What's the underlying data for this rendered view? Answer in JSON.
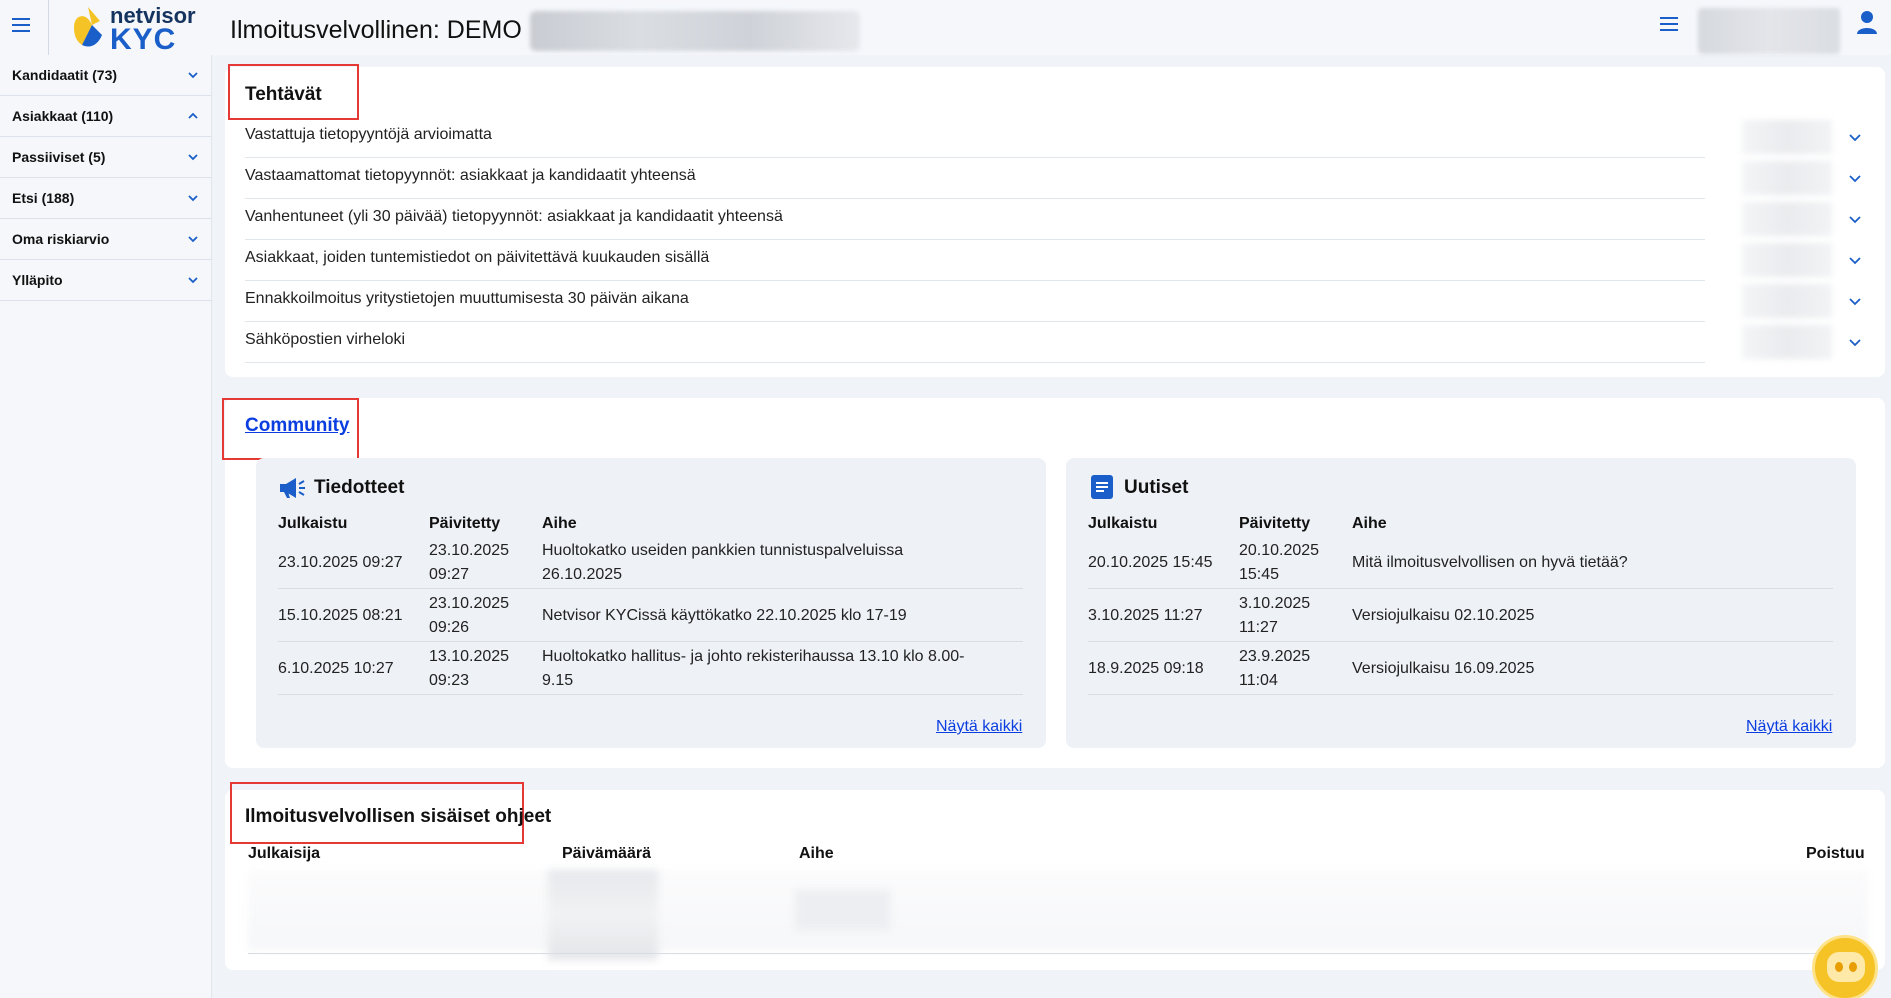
{
  "header": {
    "logo_line1": "netvisor",
    "logo_line2": "KYC",
    "title": "Ilmoitusvelvollinen: DEMO"
  },
  "sidebar": {
    "items": [
      {
        "label": "Kandidaatit (73)",
        "expanded": false
      },
      {
        "label": "Asiakkaat (110)",
        "expanded": true
      },
      {
        "label": "Passiiviset (5)",
        "expanded": false
      },
      {
        "label": "Etsi (188)",
        "expanded": false
      },
      {
        "label": "Oma riskiarvio",
        "expanded": false
      },
      {
        "label": "Ylläpito",
        "expanded": false
      }
    ]
  },
  "tasks": {
    "title": "Tehtävät",
    "rows": [
      "Vastattuja tietopyyntöjä arvioimatta",
      "Vastaamattomat tietopyynnöt: asiakkaat ja kandidaatit yhteensä",
      "Vanhentuneet (yli 30 päivää) tietopyynnöt: asiakkaat ja kandidaatit yhteensä",
      "Asiakkaat, joiden tuntemistiedot on päivitettävä kuukauden sisällä",
      "Ennakkoilmoitus yritystietojen muuttumisesta 30 päivän aikana",
      "Sähköpostien virheloki"
    ]
  },
  "community": {
    "title": "Community",
    "tiedotteet": {
      "title": "Tiedotteet",
      "columns": [
        "Julkaistu",
        "Päivitetty",
        "Aihe"
      ],
      "rows": [
        {
          "published": "23.10.2025 09:27",
          "updated_date": "23.10.2025",
          "updated_time": "09:27",
          "subject_line1": "Huoltokatko useiden pankkien tunnistuspalveluissa",
          "subject_line2": "26.10.2025"
        },
        {
          "published": "15.10.2025 08:21",
          "updated_date": "23.10.2025",
          "updated_time": "09:26",
          "subject_line1": "Netvisor KYCissä käyttökatko 22.10.2025 klo 17-19",
          "subject_line2": ""
        },
        {
          "published": "6.10.2025 10:27",
          "updated_date": "13.10.2025",
          "updated_time": "09:23",
          "subject_line1": "Huoltokatko hallitus- ja johto rekisterihaussa 13.10 klo 8.00-",
          "subject_line2": "9.15"
        }
      ],
      "show_all": "Näytä kaikki"
    },
    "uutiset": {
      "title": "Uutiset",
      "columns": [
        "Julkaistu",
        "Päivitetty",
        "Aihe"
      ],
      "rows": [
        {
          "published": "20.10.2025 15:45",
          "updated_date": "20.10.2025",
          "updated_time": "15:45",
          "subject_line1": "Mitä ilmoitusvelvollisen on hyvä tietää?",
          "subject_line2": ""
        },
        {
          "published": "3.10.2025 11:27",
          "updated_date": "3.10.2025",
          "updated_time": "11:27",
          "subject_line1": "Versiojulkaisu 02.10.2025",
          "subject_line2": ""
        },
        {
          "published": "18.9.2025 09:18",
          "updated_date": "23.9.2025",
          "updated_time": "11:04",
          "subject_line1": "Versiojulkaisu 16.09.2025",
          "subject_line2": ""
        }
      ],
      "show_all": "Näytä kaikki"
    }
  },
  "guidelines": {
    "title": "Ilmoitusvelvollisen sisäiset ohjeet",
    "columns": [
      "Julkaisija",
      "Päivämäärä",
      "Aihe",
      "Poistuu"
    ]
  },
  "colors": {
    "accent": "#1a5ec9",
    "link": "#0b3ee0",
    "highlight_border": "#e53935",
    "background": "#f0f3f8"
  },
  "icons": {
    "menu": "hamburger-icon",
    "user": "user-icon",
    "expand": "chevron-down-icon",
    "collapse": "chevron-up-icon",
    "announcements": "megaphone-icon",
    "news": "document-icon",
    "assistant": "robot-icon"
  }
}
